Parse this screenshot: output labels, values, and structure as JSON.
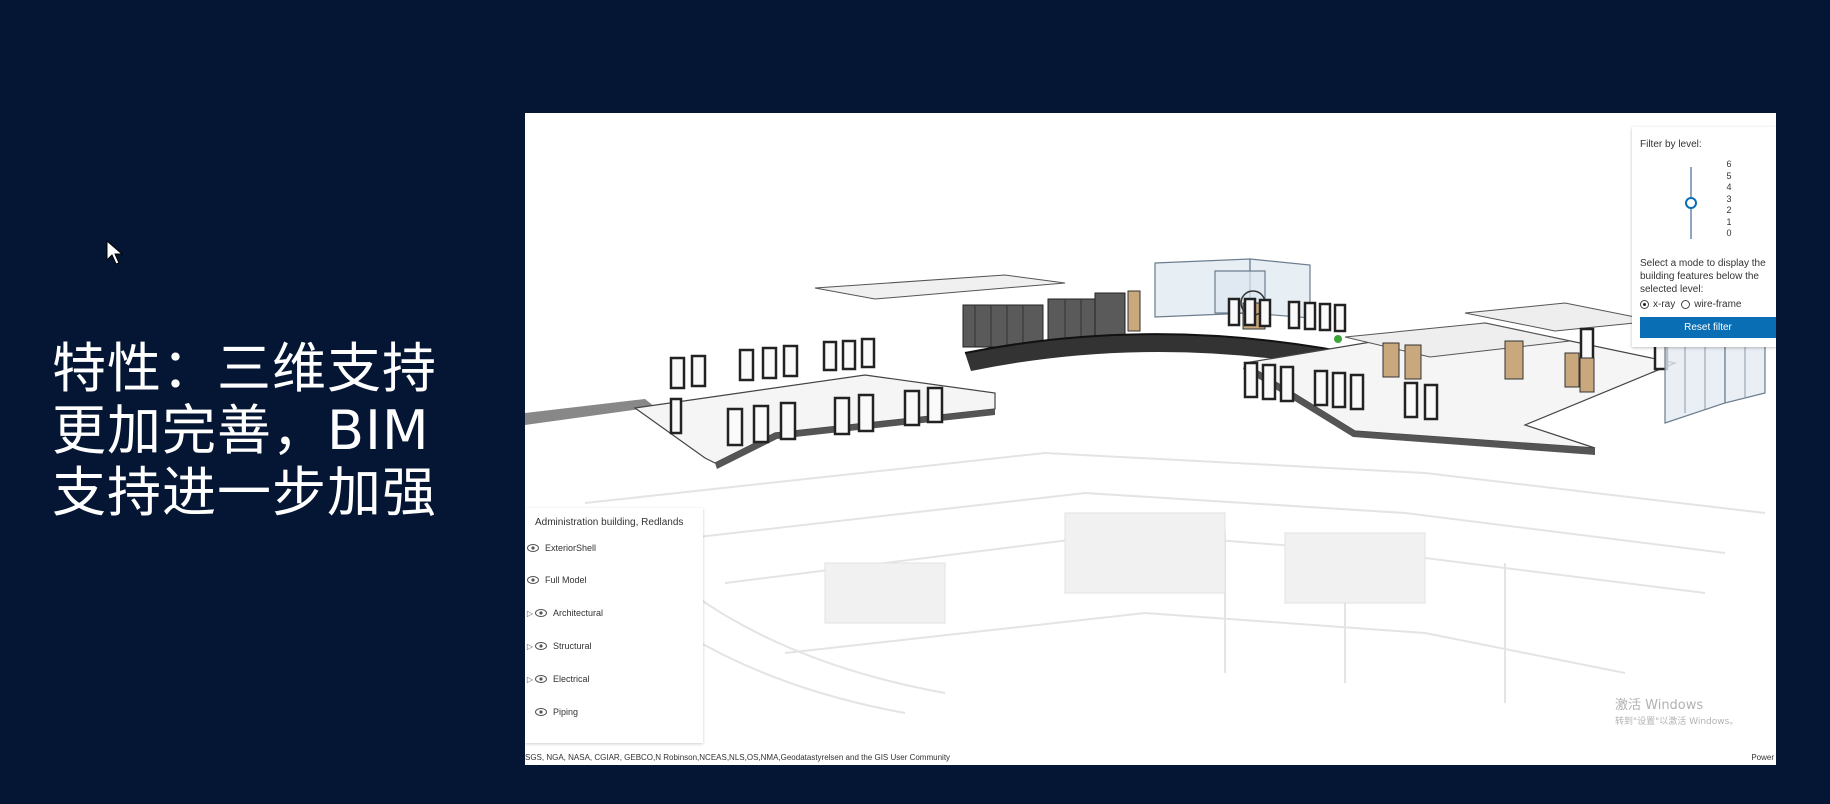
{
  "slide": {
    "headline_lines": [
      "特性：三维支持",
      "更加完善，BIM",
      "支持进一步加强"
    ]
  },
  "filter_panel": {
    "title": "Filter by level:",
    "levels": [
      "6",
      "5",
      "4",
      "3",
      "2",
      "1",
      "0"
    ],
    "selected_level": "3",
    "mode_description": "Select a mode to display the building features below the selected level:",
    "modes": [
      {
        "label": "x-ray",
        "checked": true
      },
      {
        "label": "wire-frame",
        "checked": false
      }
    ],
    "reset_label": "Reset filter",
    "accent_color": "#0a6eb4"
  },
  "layer_list": {
    "title": "Administration building, Redlands",
    "items": [
      {
        "label": "ExteriorShell",
        "expandable": false
      },
      {
        "label": "Full Model",
        "expandable": false
      },
      {
        "label": "Architectural",
        "expandable": true
      },
      {
        "label": "Structural",
        "expandable": true
      },
      {
        "label": "Electrical",
        "expandable": true
      },
      {
        "label": "Piping",
        "expandable": false
      }
    ]
  },
  "attribution": {
    "text": "SGS, NGA, NASA, CGIAR, GEBCO,N Robinson,NCEAS,NLS,OS,NMA,Geodatastyrelsen and the GIS User Community",
    "powered": "Power"
  },
  "watermark": {
    "line1": "激活 Windows",
    "line2": "转到\"设置\"以激活 Windows。"
  },
  "colors": {
    "background": "#041633",
    "headline": "#ffffff"
  }
}
